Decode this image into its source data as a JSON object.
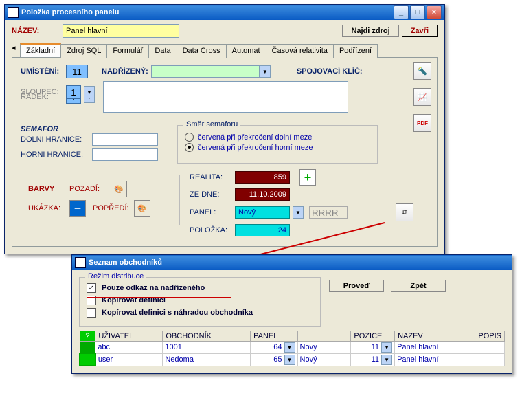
{
  "win1": {
    "title": "Položka procesního panelu",
    "nazev_label": "NÁZEV:",
    "nazev_value": "Panel hlavní",
    "btn_find": "Najdi zdroj",
    "btn_close": "Zavři",
    "tabs": [
      "Základní",
      "Zdroj SQL",
      "Formulář",
      "Data",
      "Data Cross",
      "Automat",
      "Časová relativita",
      "Podřízení"
    ],
    "umisteni_label": "UMÍSTĚNÍ:",
    "umisteni": "11",
    "radek_label": "ŘÁDEK:",
    "radek": "1",
    "sloupec_label": "SLOUPEC:",
    "sloupec": "1",
    "nadrizeny_label": "NADŘÍZENÝ:",
    "spojklic_label": "SPOJOVACÍ KLÍČ:",
    "semafor_heading": "SEMAFOR",
    "dolni_label": "DOLNI HRANICE:",
    "horni_label": "HORNI HRANICE:",
    "smer_title": "Směr semaforu",
    "smer_opt1": "červená při překročení dolní meze",
    "smer_opt2": "červená při překročení horní meze",
    "barvy": "BARVY",
    "pozadi": "POZADÍ:",
    "ukazka": "UKÁZKA:",
    "popredi": "POPŘEDÍ:",
    "realita": "REALITA:",
    "realita_v": "859",
    "zedne": "ZE DNE:",
    "zedne_v": "11.10.2009",
    "panel": "PANEL:",
    "panel_v": "Nový",
    "rrrr": "RRRR",
    "polozka": "POLOŽKA:",
    "polozka_v": "24"
  },
  "win2": {
    "title": "Seznam obchodníků",
    "grp": "Režim distribuce",
    "opt1": "Pouze odkaz na nadřízeného",
    "opt2": "Kopírovat definici",
    "opt3": "Kopírovat definici s náhradou obchodníka",
    "btn_go": "Proveď",
    "btn_back": "Zpět",
    "cols": {
      "q": "?",
      "uziv": "UŽIVATEL",
      "obch": "OBCHODNÍK",
      "panel": "PANEL",
      "blank": "",
      "pozice": "POZICE",
      "nazev": "NAZEV",
      "popis": "POPIS"
    },
    "rows": [
      {
        "uziv": "abc",
        "obch": "1001",
        "panel": "64",
        "sel": "Nový",
        "poz": "11",
        "nazev": "Panel hlavní",
        "popis": ""
      },
      {
        "uziv": "user",
        "obch": "Nedoma",
        "panel": "65",
        "sel": "Nový",
        "poz": "11",
        "nazev": "Panel hlavní",
        "popis": ""
      }
    ]
  }
}
